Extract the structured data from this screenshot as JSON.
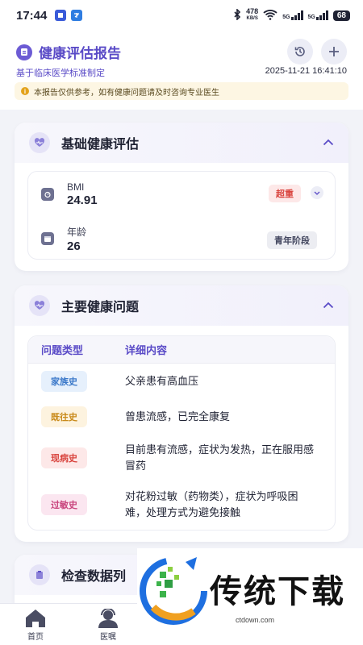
{
  "status_bar": {
    "time": "17:44",
    "net_speed": "478",
    "net_unit": "KB/S",
    "sig1": "5G",
    "sig2": "5G",
    "battery": "68"
  },
  "header": {
    "title": "健康评估报告",
    "subtitle": "基于临床医学标准制定",
    "timestamp": "2025-11-21 16:41:10",
    "notice": "本报告仅供参考，如有健康问题请及时咨询专业医生"
  },
  "basic_card": {
    "title": "基础健康评估",
    "bmi": {
      "label": "BMI",
      "value": "24.91",
      "badge": "超重"
    },
    "age": {
      "label": "年龄",
      "value": "26",
      "badge": "青年阶段"
    }
  },
  "issues_card": {
    "title": "主要健康问题",
    "col_type": "问题类型",
    "col_detail": "详细内容",
    "rows": [
      {
        "tag": "家族史",
        "detail": "父亲患有高血压"
      },
      {
        "tag": "既往史",
        "detail": "曾患流感，已完全康复"
      },
      {
        "tag": "现病史",
        "detail": "目前患有流感，症状为发热，正在服用感冒药"
      },
      {
        "tag": "过敏史",
        "detail": "对花粉过敏（药物类），症状为呼吸困难，处理方式为避免接触"
      }
    ]
  },
  "data_card": {
    "title": "检查数据列"
  },
  "bottom_nav": {
    "home": "首页",
    "advice": "医嘱"
  },
  "watermark": {
    "text": "传统下载",
    "url": "ctdown.com"
  },
  "colors": {
    "accent": "#5a4bc7",
    "overweight": "#d9453f",
    "tag_family_bg": "#e6f0fc",
    "tag_family_fg": "#3a78c9",
    "tag_past_bg": "#fdf3df",
    "tag_past_fg": "#c98a1a",
    "tag_current_bg": "#fde8e8",
    "tag_current_fg": "#d9453f",
    "tag_allergy_bg": "#fbe6f0",
    "tag_allergy_fg": "#c9457e"
  }
}
